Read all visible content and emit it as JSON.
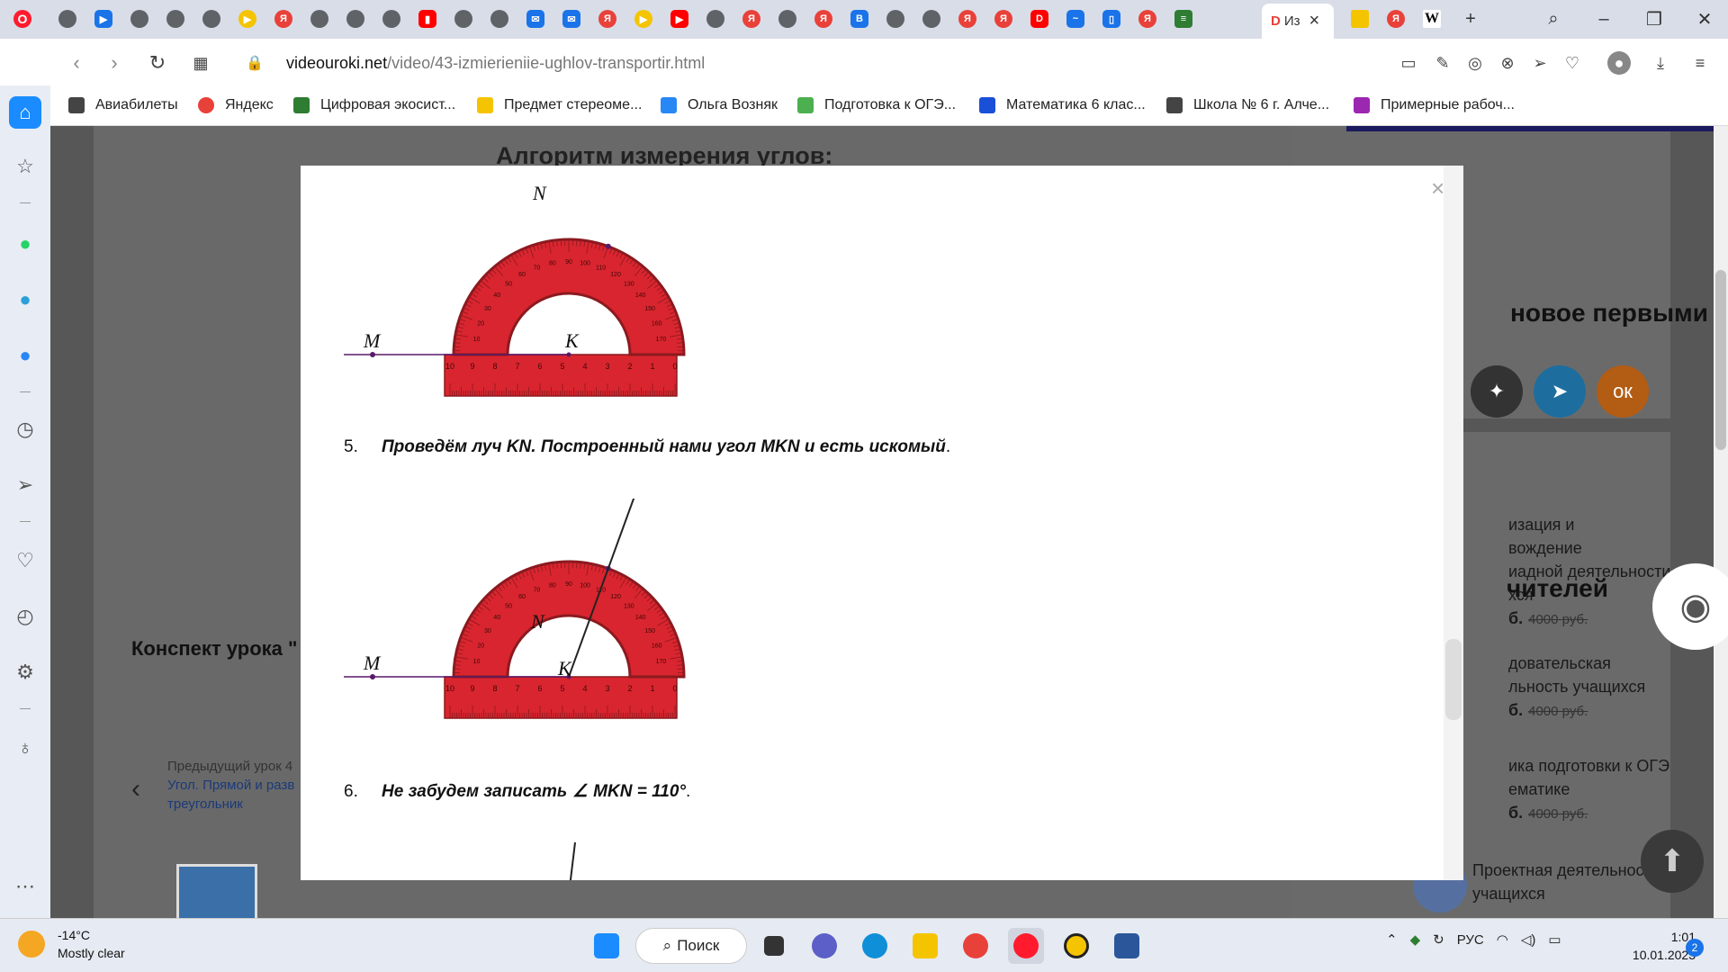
{
  "browser": {
    "active_tab_label": "Из",
    "url_domain": "videouroki.net",
    "url_path": "/video/43-izmierieniie-ughlov-transportir.html"
  },
  "bookmarks": [
    {
      "label": "Авиабилеты"
    },
    {
      "label": "Яндекс"
    },
    {
      "label": "Цифровая экосист..."
    },
    {
      "label": "Предмет стереоме..."
    },
    {
      "label": "Ольга Возняк"
    },
    {
      "label": "Подготовка к ОГЭ..."
    },
    {
      "label": "Математика 6 клас..."
    },
    {
      "label": "Школа № 6 г. Алче..."
    },
    {
      "label": "Примерные рабоч..."
    }
  ],
  "page": {
    "heading": "Алгоритм измерения углов:",
    "konspekt_title": "Конспект урока \"",
    "prev_label": "Предыдущий урок 4",
    "prev_title_1": "Угол. Прямой и разв",
    "prev_title_2": "треугольник",
    "follow_title": "новое первыми",
    "teachers_title": "чителей",
    "courses": [
      {
        "l1": "изация и",
        "l2": "вождение",
        "l3": "иадной деятельности",
        "l4": "хся",
        "price": "б.",
        "old": "4000 руб."
      },
      {
        "l1": "довательская",
        "l2": "льность учащихся",
        "price": "б.",
        "old": "4000 руб."
      },
      {
        "l1": "ика подготовки к ОГЭ",
        "l2": "ематике",
        "price": "б.",
        "old": "4000 руб."
      }
    ],
    "last_course_1": "Проектная деятельность",
    "last_course_2": "учащихся"
  },
  "modal": {
    "close": "×",
    "step5_num": "5.",
    "step5_text": "Проведём луч KN. Построенный нами угол MKN и есть искомый",
    "step5_end": ".",
    "step6_num": "6.",
    "step6_text": "Не забудем записать",
    "step6_angle": "∠",
    "step6_value": "MKN = 110°",
    "step6_end": ".",
    "label_M": "M",
    "label_N": "N",
    "label_K": "K",
    "ruler_numbers": [
      "10",
      "9",
      "8",
      "7",
      "6",
      "5",
      "4",
      "3",
      "2",
      "1",
      "0"
    ],
    "protractor_numbers": [
      "10",
      "20",
      "30",
      "40",
      "50",
      "60",
      "70",
      "80",
      "90",
      "100",
      "110",
      "120",
      "130",
      "140",
      "150",
      "160",
      "170"
    ]
  },
  "taskbar": {
    "temp": "-14°C",
    "weather": "Mostly clear",
    "search": "Поиск",
    "lang": "РУС",
    "time": "1:01",
    "date": "10.01.2023",
    "notifications": "2"
  },
  "colors": {
    "protractor": "#d9252f",
    "protractor_dark": "#8b1a1f",
    "accent": "#1a8cff"
  }
}
